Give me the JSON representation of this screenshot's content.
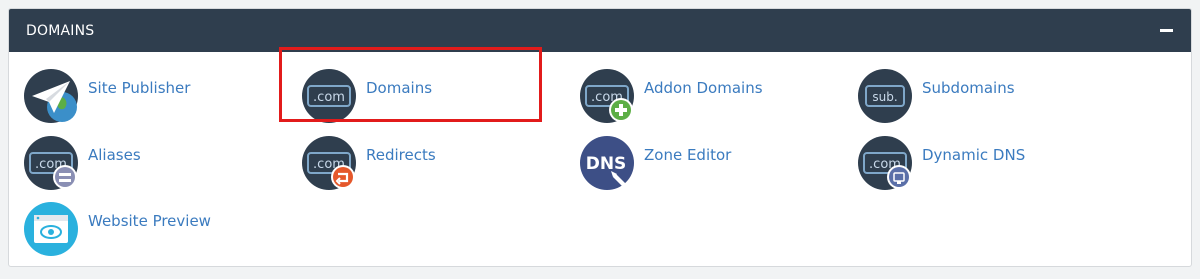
{
  "section": {
    "title": "DOMAINS"
  },
  "items": [
    {
      "label": "Site Publisher"
    },
    {
      "label": "Domains"
    },
    {
      "label": "Addon Domains"
    },
    {
      "label": "Subdomains"
    },
    {
      "label": "Aliases"
    },
    {
      "label": "Redirects"
    },
    {
      "label": "Zone Editor"
    },
    {
      "label": "Dynamic DNS"
    },
    {
      "label": "Website Preview"
    }
  ],
  "icon_text": {
    "com": ".com",
    "sub": "sub.",
    "dns": "DNS"
  },
  "colors": {
    "header_bg": "#2f3e4e",
    "link": "#3b7bbf",
    "icon_dark": "#2f3e4e",
    "highlight": "#e21b1b",
    "addon_badge": "#5cae45",
    "redirect_badge": "#e5582b",
    "alias_badge": "#8a8fb4",
    "preview_bg": "#2ab1de"
  }
}
